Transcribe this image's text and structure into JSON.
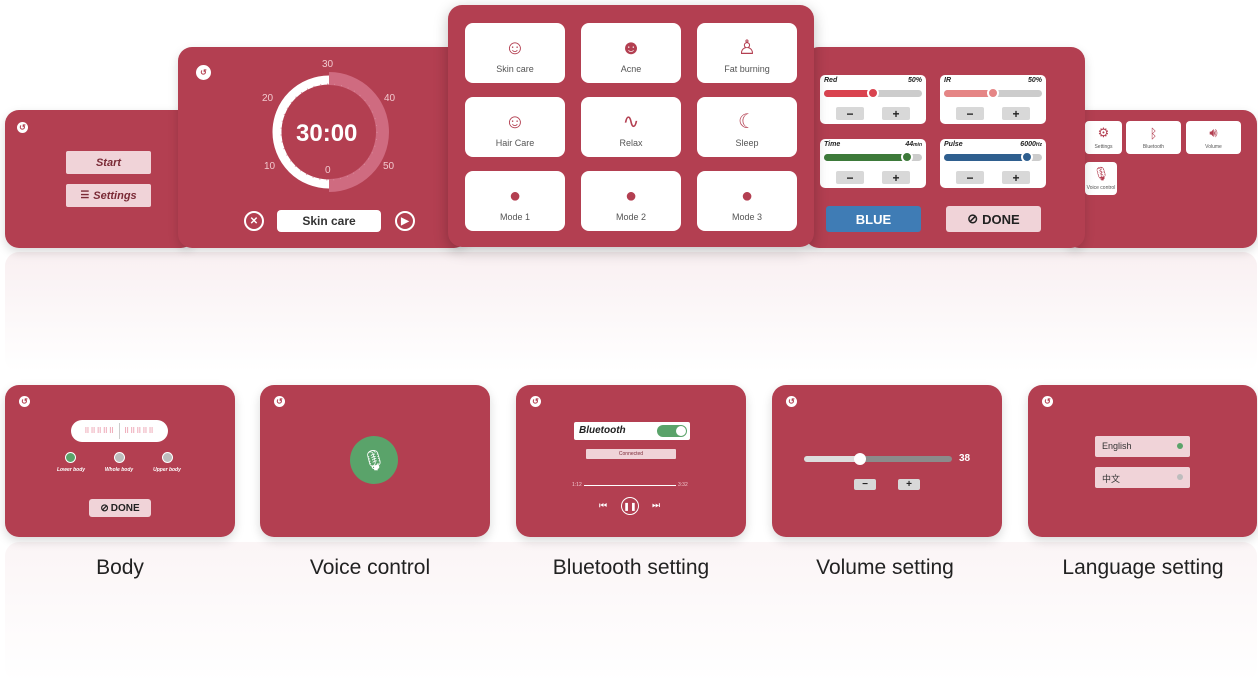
{
  "main_menu": {
    "start_label": "Start",
    "settings_label": "Settings"
  },
  "timer": {
    "dial_numbers": [
      "30",
      "40",
      "50",
      "0",
      "10",
      "20"
    ],
    "time": "30:00",
    "mode": "Skin care",
    "remaining_fraction": 0.5
  },
  "modes": [
    {
      "label": "Skin care",
      "icon": "face-care-icon"
    },
    {
      "label": "Acne",
      "icon": "acne-face-icon"
    },
    {
      "label": "Fat burning",
      "icon": "fat-burning-icon"
    },
    {
      "label": "Hair Care",
      "icon": "hair-care-icon"
    },
    {
      "label": "Relax",
      "icon": "relax-icon"
    },
    {
      "label": "Sleep",
      "icon": "sleep-icon"
    },
    {
      "label": "Mode 1",
      "icon": "user-icon"
    },
    {
      "label": "Mode 2",
      "icon": "user-icon"
    },
    {
      "label": "Mode 3",
      "icon": "user-icon"
    }
  ],
  "sliders": [
    {
      "name": "Red",
      "value": "50%",
      "unit": "",
      "level": 0.5,
      "color": "#d9434f"
    },
    {
      "name": "IR",
      "value": "50%",
      "unit": "",
      "level": 0.5,
      "color": "#e58585"
    },
    {
      "name": "Time",
      "value": "44",
      "unit": "min",
      "level": 0.85,
      "color": "#3d7a3a"
    },
    {
      "name": "Pulse",
      "value": "6000",
      "unit": "Hz",
      "level": 0.85,
      "color": "#2f5f8f"
    }
  ],
  "color_button": {
    "label": "BLUE",
    "color": "#3f7cb5"
  },
  "done_label": "DONE",
  "settings_tiles": [
    {
      "label": "Settings",
      "icon": "gear-icon"
    },
    {
      "label": "Bluetooth",
      "icon": "bluetooth-icon"
    },
    {
      "label": "Volume",
      "icon": "volume-icon"
    },
    {
      "label": "Voice control",
      "icon": "microphone-icon"
    }
  ],
  "body_screen": {
    "options": [
      "Lower body",
      "Whole body",
      "Upper body"
    ],
    "done_label": "DONE"
  },
  "bluetooth_screen": {
    "label": "Bluetooth",
    "status": "Connected",
    "elapsed": "1:12",
    "duration": "3:32"
  },
  "volume_screen": {
    "value": "38",
    "level": 0.38
  },
  "language_screen": {
    "options": [
      "English",
      "中文"
    ]
  },
  "captions": [
    "Body",
    "Voice control",
    "Bluetooth setting",
    "Volume setting",
    "Language setting"
  ],
  "colors": {
    "panel": "#b33f51",
    "accent": "#b33f51",
    "green": "#5aa36a"
  }
}
